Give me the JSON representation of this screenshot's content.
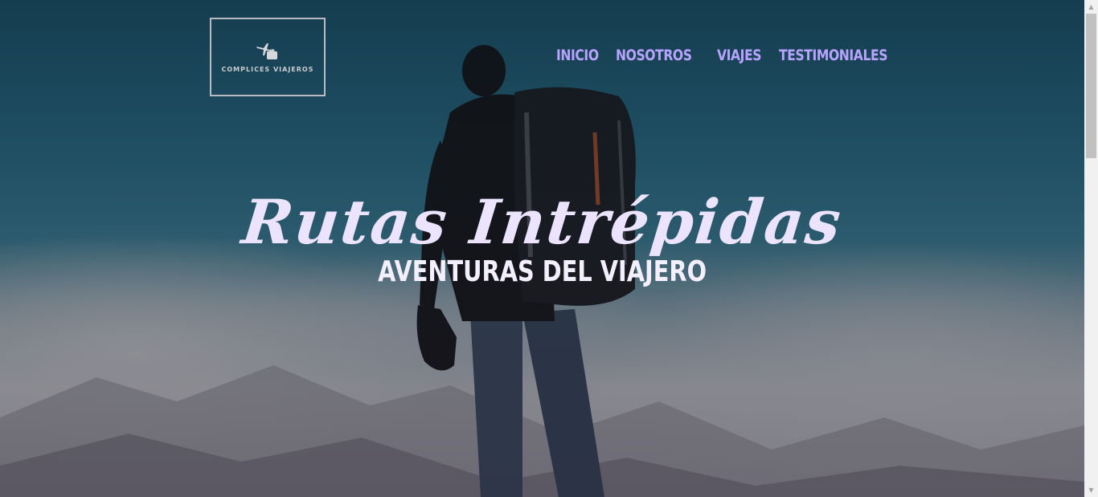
{
  "brand": {
    "name": "COMPLICES VIAJEROS",
    "icon": "plane-suitcase-icon"
  },
  "nav": {
    "items": [
      {
        "label": "INICIO"
      },
      {
        "label": "NOSOTROS"
      },
      {
        "label": "VIAJES"
      },
      {
        "label": "TESTIMONIALES"
      }
    ]
  },
  "hero": {
    "title": "Rutas Intrépidas",
    "subtitle": "AVENTURAS DEL VIAJERO"
  },
  "colors": {
    "nav_link": "#b8a3ff",
    "title": "#ece4ff",
    "logo_border": "#b9bdc3"
  }
}
